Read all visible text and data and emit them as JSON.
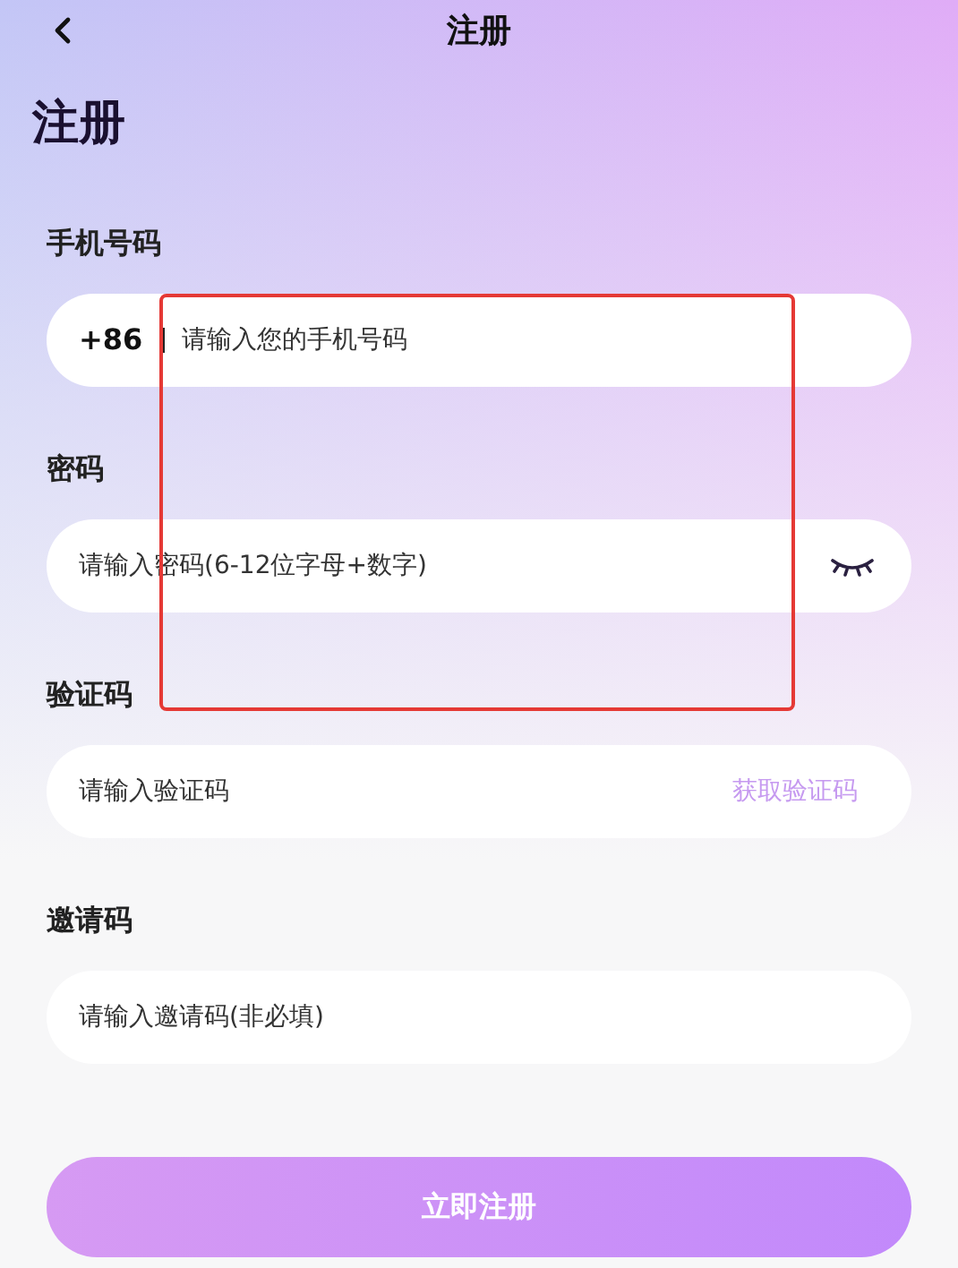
{
  "nav": {
    "title": "注册"
  },
  "heading": "注册",
  "fields": [
    {
      "kind": "phone",
      "label": "手机号码",
      "prefix": "+86",
      "placeholder": "请输入您的手机号码"
    },
    {
      "kind": "password",
      "label": "密码",
      "placeholder": "请输入密码(6-12位字母+数字)"
    },
    {
      "kind": "code",
      "label": "验证码",
      "placeholder": "请输入验证码",
      "action": "获取验证码"
    },
    {
      "kind": "plain",
      "label": "邀请码",
      "placeholder": "请输入邀请码(非必填)"
    }
  ],
  "submit": "立即注册",
  "annotation": {
    "kind": "highlight-box"
  }
}
